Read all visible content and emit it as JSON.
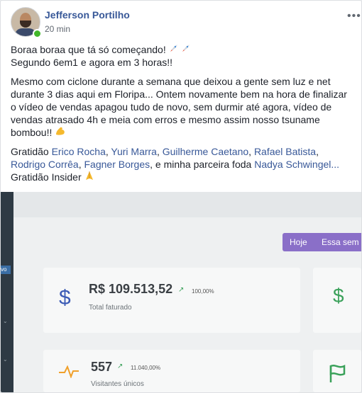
{
  "post": {
    "author": "Jefferson Portilho",
    "time": "20 min",
    "line1": "Boraa boraa que tá só começando!",
    "line2": "Segundo 6em1 e agora em 3 horas!!",
    "paragraph": "Mesmo com ciclone durante a semana que deixou a gente sem luz e net durante 3 dias aqui em Floripa... Ontem novamente bem na hora de finalizar o vídeo de vendas apagou tudo de novo, sem durmir até agora, vídeo de vendas atrasado 4h e meia com erros e mesmo assim nosso tsuname bombou!!",
    "thanks_prefix": "Gratidão",
    "tags": [
      "Erico Rocha",
      "Yuri Marra",
      "Guilherme Caetano",
      "Rafael Batista",
      "Rodrigo Corrêa",
      "Fagner Borges"
    ],
    "thanks_middle": ", e minha parceira foda",
    "partner": "Nadya Schwingel...",
    "thanks_insider": "Gratidão Insider"
  },
  "icons": {
    "more": "more-options-icon",
    "rocket": "rocket-emoji-icon",
    "flex": "flexed-bicep-emoji-icon",
    "pray": "praying-hands-emoji-icon"
  },
  "dashboard": {
    "filter_today": "Hoje",
    "filter_week": "Essa sem",
    "revenue_value": "R$ 109.513,52",
    "revenue_pct": "100,00%",
    "revenue_label": "Total faturado",
    "visitors_value": "557",
    "visitors_pct": "11.040,00%",
    "visitors_label": "Visitantes únicos",
    "sidebar_tag": "vo",
    "accent_color": "#8a6fc8"
  }
}
